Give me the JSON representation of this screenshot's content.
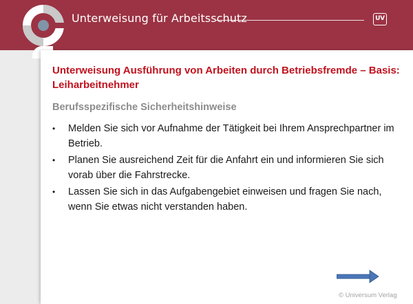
{
  "header": {
    "title": "Unterweisung für Arbeitsschutz",
    "badge": "UV"
  },
  "slide": {
    "title": "Unterweisung Ausführung von Arbeiten durch Betriebsfremde – Basis: Leiharbeitnehmer",
    "subtitle": "Berufsspezifische Sicherheitshinweise",
    "bullets": [
      "Melden Sie sich vor Aufnahme der Tätigkeit bei Ihrem Ansprechpartner im Betrieb.",
      "Planen Sie ausreichend Zeit für die Anfahrt ein und informieren Sie sich vorab über die Fahrstrecke.",
      "Lassen Sie sich in das Aufgabengebiet einweisen und fragen Sie nach, wenn Sie etwas nicht verstanden haben."
    ],
    "bullet_glyph": "•"
  },
  "footer": {
    "copyright": "© Universum Verlag"
  },
  "colors": {
    "header_bg": "#9b3344",
    "title_red": "#c0121e",
    "subtitle_gray": "#8c8c8c",
    "arrow_blue": "#4a76b8"
  },
  "icons": {
    "logo": "ring-logo-icon",
    "next": "arrow-right-icon"
  }
}
